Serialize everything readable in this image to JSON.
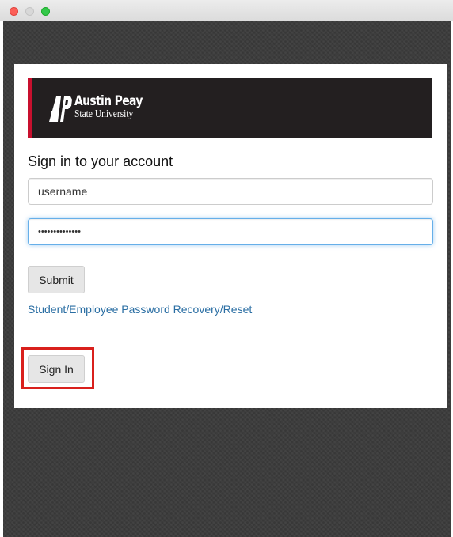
{
  "window": {
    "controls": [
      "close",
      "minimize",
      "maximize"
    ]
  },
  "banner": {
    "logo_mark": "AP",
    "logo_line1": "Austin Peay",
    "logo_line2": "State University"
  },
  "form": {
    "heading": "Sign in to your account",
    "username_value": "username",
    "password_value": "••••••••••••••",
    "submit_label": "Submit",
    "recovery_link": "Student/Employee Password Recovery/Reset",
    "signin_label": "Sign In"
  },
  "colors": {
    "brand_red": "#c8102e",
    "banner_bg": "#231f20",
    "link": "#2a6ea3",
    "highlight": "#d9201c"
  }
}
